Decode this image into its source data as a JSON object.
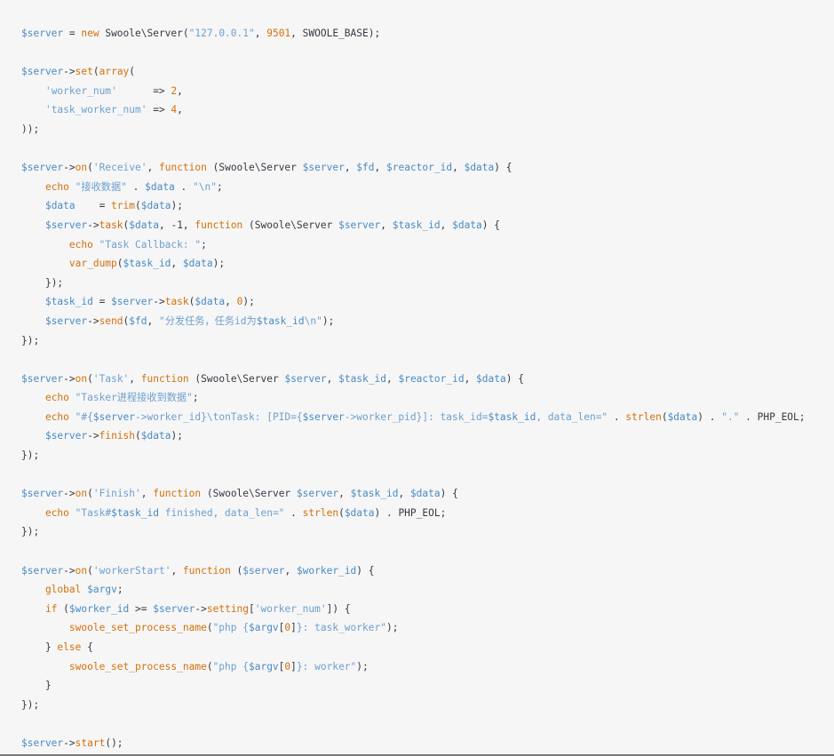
{
  "code": {
    "language": "php",
    "lines": [
      [
        [
          "$server",
          "v"
        ],
        [
          " = ",
          "p"
        ],
        [
          "new",
          "k"
        ],
        [
          " Swoole\\Server(",
          "p"
        ],
        [
          "\"127.0.0.1\"",
          "s"
        ],
        [
          ", ",
          "p"
        ],
        [
          "9501",
          "n"
        ],
        [
          ", SWOOLE_BASE);",
          "p"
        ]
      ],
      [],
      [
        [
          "$server",
          "v"
        ],
        [
          "->",
          "p"
        ],
        [
          "set",
          "f"
        ],
        [
          "(",
          "p"
        ],
        [
          "array",
          "f"
        ],
        [
          "(",
          "p"
        ]
      ],
      [
        [
          "    ",
          "p"
        ],
        [
          "'worker_num'",
          "s"
        ],
        [
          "      => ",
          "p"
        ],
        [
          "2",
          "n"
        ],
        [
          ",",
          "p"
        ]
      ],
      [
        [
          "    ",
          "p"
        ],
        [
          "'task_worker_num'",
          "s"
        ],
        [
          " => ",
          "p"
        ],
        [
          "4",
          "n"
        ],
        [
          ",",
          "p"
        ]
      ],
      [
        [
          "));",
          "p"
        ]
      ],
      [],
      [
        [
          "$server",
          "v"
        ],
        [
          "->",
          "p"
        ],
        [
          "on",
          "f"
        ],
        [
          "(",
          "p"
        ],
        [
          "'Receive'",
          "s"
        ],
        [
          ", ",
          "p"
        ],
        [
          "function",
          "k"
        ],
        [
          " (Swoole\\Server ",
          "p"
        ],
        [
          "$server",
          "v"
        ],
        [
          ", ",
          "p"
        ],
        [
          "$fd",
          "v"
        ],
        [
          ", ",
          "p"
        ],
        [
          "$reactor_id",
          "v"
        ],
        [
          ", ",
          "p"
        ],
        [
          "$data",
          "v"
        ],
        [
          ") {",
          "p"
        ]
      ],
      [
        [
          "    ",
          "p"
        ],
        [
          "echo",
          "k"
        ],
        [
          " ",
          "p"
        ],
        [
          "\"接收数据\"",
          "s"
        ],
        [
          " . ",
          "p"
        ],
        [
          "$data",
          "v"
        ],
        [
          " . ",
          "p"
        ],
        [
          "\"\\n\"",
          "s"
        ],
        [
          ";",
          "p"
        ]
      ],
      [
        [
          "    ",
          "p"
        ],
        [
          "$data",
          "v"
        ],
        [
          "    = ",
          "p"
        ],
        [
          "trim",
          "f"
        ],
        [
          "(",
          "p"
        ],
        [
          "$data",
          "v"
        ],
        [
          ");",
          "p"
        ]
      ],
      [
        [
          "    ",
          "p"
        ],
        [
          "$server",
          "v"
        ],
        [
          "->",
          "p"
        ],
        [
          "task",
          "f"
        ],
        [
          "(",
          "p"
        ],
        [
          "$data",
          "v"
        ],
        [
          ", -1, ",
          "p"
        ],
        [
          "function",
          "k"
        ],
        [
          " (Swoole\\Server ",
          "p"
        ],
        [
          "$server",
          "v"
        ],
        [
          ", ",
          "p"
        ],
        [
          "$task_id",
          "v"
        ],
        [
          ", ",
          "p"
        ],
        [
          "$data",
          "v"
        ],
        [
          ") {",
          "p"
        ]
      ],
      [
        [
          "        ",
          "p"
        ],
        [
          "echo",
          "k"
        ],
        [
          " ",
          "p"
        ],
        [
          "\"Task Callback: \"",
          "s"
        ],
        [
          ";",
          "p"
        ]
      ],
      [
        [
          "        ",
          "p"
        ],
        [
          "var_dump",
          "f"
        ],
        [
          "(",
          "p"
        ],
        [
          "$task_id",
          "v"
        ],
        [
          ", ",
          "p"
        ],
        [
          "$data",
          "v"
        ],
        [
          ");",
          "p"
        ]
      ],
      [
        [
          "    ",
          "p"
        ],
        [
          "});",
          "p"
        ]
      ],
      [
        [
          "    ",
          "p"
        ],
        [
          "$task_id",
          "v"
        ],
        [
          " = ",
          "p"
        ],
        [
          "$server",
          "v"
        ],
        [
          "->",
          "p"
        ],
        [
          "task",
          "f"
        ],
        [
          "(",
          "p"
        ],
        [
          "$data",
          "v"
        ],
        [
          ", ",
          "p"
        ],
        [
          "0",
          "n"
        ],
        [
          ");",
          "p"
        ]
      ],
      [
        [
          "    ",
          "p"
        ],
        [
          "$server",
          "v"
        ],
        [
          "->",
          "p"
        ],
        [
          "send",
          "f"
        ],
        [
          "(",
          "p"
        ],
        [
          "$fd",
          "v"
        ],
        [
          ", ",
          "p"
        ],
        [
          "\"分发任务，任务id为",
          "s"
        ],
        [
          "$task_id",
          "v"
        ],
        [
          "\\n\"",
          "s"
        ],
        [
          ");",
          "p"
        ]
      ],
      [
        [
          "});",
          "p"
        ]
      ],
      [],
      [
        [
          "$server",
          "v"
        ],
        [
          "->",
          "p"
        ],
        [
          "on",
          "f"
        ],
        [
          "(",
          "p"
        ],
        [
          "'Task'",
          "s"
        ],
        [
          ", ",
          "p"
        ],
        [
          "function",
          "k"
        ],
        [
          " (Swoole\\Server ",
          "p"
        ],
        [
          "$server",
          "v"
        ],
        [
          ", ",
          "p"
        ],
        [
          "$task_id",
          "v"
        ],
        [
          ", ",
          "p"
        ],
        [
          "$reactor_id",
          "v"
        ],
        [
          ", ",
          "p"
        ],
        [
          "$data",
          "v"
        ],
        [
          ") {",
          "p"
        ]
      ],
      [
        [
          "    ",
          "p"
        ],
        [
          "echo",
          "k"
        ],
        [
          " ",
          "p"
        ],
        [
          "\"Tasker进程接收到数据\"",
          "s"
        ],
        [
          ";",
          "p"
        ]
      ],
      [
        [
          "    ",
          "p"
        ],
        [
          "echo",
          "k"
        ],
        [
          " ",
          "p"
        ],
        [
          "\"#{",
          "s"
        ],
        [
          "$server",
          "v"
        ],
        [
          "->worker_id",
          "s"
        ],
        [
          "}\\tonTask: [PID={",
          "s"
        ],
        [
          "$server",
          "v"
        ],
        [
          "->worker_pid",
          "s"
        ],
        [
          "}]: task_id=",
          "s"
        ],
        [
          "$task_id",
          "v"
        ],
        [
          ", data_len=\"",
          "s"
        ],
        [
          " . ",
          "p"
        ],
        [
          "strlen",
          "f"
        ],
        [
          "(",
          "p"
        ],
        [
          "$data",
          "v"
        ],
        [
          ") . ",
          "p"
        ],
        [
          "\".\"",
          "s"
        ],
        [
          " . PHP_EOL;",
          "p"
        ]
      ],
      [
        [
          "    ",
          "p"
        ],
        [
          "$server",
          "v"
        ],
        [
          "->",
          "p"
        ],
        [
          "finish",
          "f"
        ],
        [
          "(",
          "p"
        ],
        [
          "$data",
          "v"
        ],
        [
          ");",
          "p"
        ]
      ],
      [
        [
          "});",
          "p"
        ]
      ],
      [],
      [
        [
          "$server",
          "v"
        ],
        [
          "->",
          "p"
        ],
        [
          "on",
          "f"
        ],
        [
          "(",
          "p"
        ],
        [
          "'Finish'",
          "s"
        ],
        [
          ", ",
          "p"
        ],
        [
          "function",
          "k"
        ],
        [
          " (Swoole\\Server ",
          "p"
        ],
        [
          "$server",
          "v"
        ],
        [
          ", ",
          "p"
        ],
        [
          "$task_id",
          "v"
        ],
        [
          ", ",
          "p"
        ],
        [
          "$data",
          "v"
        ],
        [
          ") {",
          "p"
        ]
      ],
      [
        [
          "    ",
          "p"
        ],
        [
          "echo",
          "k"
        ],
        [
          " ",
          "p"
        ],
        [
          "\"Task#",
          "s"
        ],
        [
          "$task_id",
          "v"
        ],
        [
          " finished, data_len=\"",
          "s"
        ],
        [
          " . ",
          "p"
        ],
        [
          "strlen",
          "f"
        ],
        [
          "(",
          "p"
        ],
        [
          "$data",
          "v"
        ],
        [
          ") . PHP_EOL;",
          "p"
        ]
      ],
      [
        [
          "});",
          "p"
        ]
      ],
      [],
      [
        [
          "$server",
          "v"
        ],
        [
          "->",
          "p"
        ],
        [
          "on",
          "f"
        ],
        [
          "(",
          "p"
        ],
        [
          "'workerStart'",
          "s"
        ],
        [
          ", ",
          "p"
        ],
        [
          "function",
          "k"
        ],
        [
          " (",
          "p"
        ],
        [
          "$server",
          "v"
        ],
        [
          ", ",
          "p"
        ],
        [
          "$worker_id",
          "v"
        ],
        [
          ") {",
          "p"
        ]
      ],
      [
        [
          "    ",
          "p"
        ],
        [
          "global",
          "k"
        ],
        [
          " ",
          "p"
        ],
        [
          "$argv",
          "v"
        ],
        [
          ";",
          "p"
        ]
      ],
      [
        [
          "    ",
          "p"
        ],
        [
          "if",
          "k"
        ],
        [
          " (",
          "p"
        ],
        [
          "$worker_id",
          "v"
        ],
        [
          " >= ",
          "p"
        ],
        [
          "$server",
          "v"
        ],
        [
          "->",
          "p"
        ],
        [
          "setting",
          "f"
        ],
        [
          "[",
          "p"
        ],
        [
          "'worker_num'",
          "s"
        ],
        [
          "]) {",
          "p"
        ]
      ],
      [
        [
          "        ",
          "p"
        ],
        [
          "swoole_set_process_name",
          "f"
        ],
        [
          "(",
          "p"
        ],
        [
          "\"php {",
          "s"
        ],
        [
          "$argv",
          "v"
        ],
        [
          "[",
          "p"
        ],
        [
          "0",
          "n"
        ],
        [
          "]",
          "p"
        ],
        [
          "}: task_worker\"",
          "s"
        ],
        [
          ");",
          "p"
        ]
      ],
      [
        [
          "    } ",
          "p"
        ],
        [
          "else",
          "k"
        ],
        [
          " {",
          "p"
        ]
      ],
      [
        [
          "        ",
          "p"
        ],
        [
          "swoole_set_process_name",
          "f"
        ],
        [
          "(",
          "p"
        ],
        [
          "\"php {",
          "s"
        ],
        [
          "$argv",
          "v"
        ],
        [
          "[",
          "p"
        ],
        [
          "0",
          "n"
        ],
        [
          "]",
          "p"
        ],
        [
          "}: worker\"",
          "s"
        ],
        [
          ");",
          "p"
        ]
      ],
      [
        [
          "    }",
          "p"
        ]
      ],
      [
        [
          "});",
          "p"
        ]
      ],
      [],
      [
        [
          "$server",
          "v"
        ],
        [
          "->",
          "p"
        ],
        [
          "start",
          "f"
        ],
        [
          "();",
          "p"
        ]
      ]
    ]
  }
}
